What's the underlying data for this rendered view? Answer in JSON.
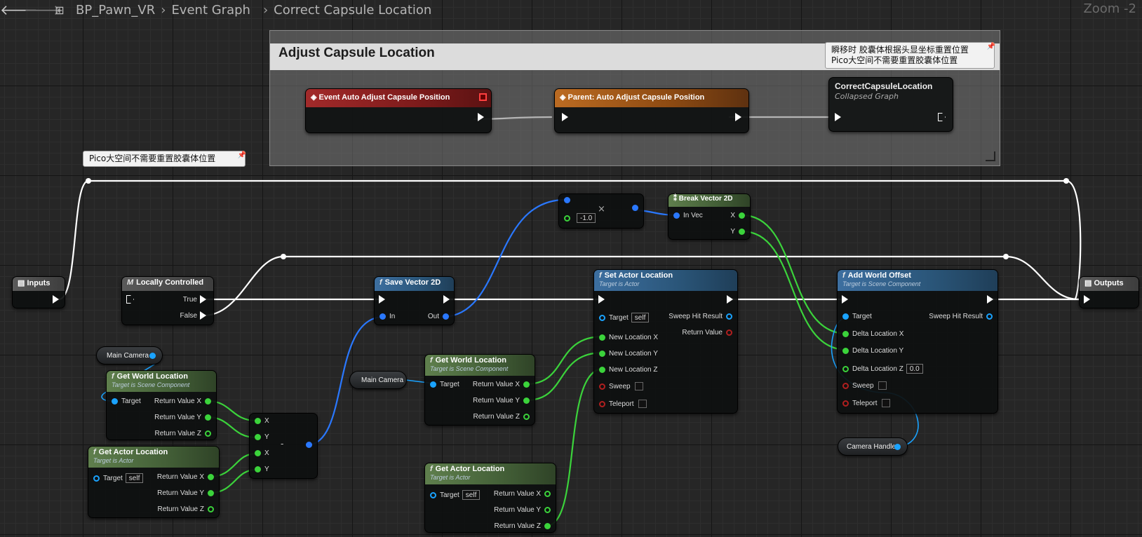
{
  "toolbar": {
    "breadcrumb": [
      "BP_Pawn_VR",
      "Event Graph",
      "Correct Capsule Location"
    ],
    "zoom": "Zoom -2",
    "back_icon": "back-arrow-icon",
    "forward_icon": "forward-arrow-icon",
    "graph_icon": "blueprint-graph-icon"
  },
  "comment_box": {
    "title": "Adjust Capsule Location"
  },
  "bubbles": {
    "correct_capsule": [
      "瞬移时 胶囊体根据头显坐标重置位置",
      "Pico大空间不需要重置胶囊体位置"
    ],
    "reroute": "Pico大空间不需要重置胶囊体位置"
  },
  "nodes": {
    "event_adjust": {
      "title": "Event Auto Adjust Capsule Position"
    },
    "parent_adjust": {
      "title": "Parent: Auto Adjust Capsule Position"
    },
    "collapsed": {
      "title": "CorrectCapsuleLocation",
      "subtitle": "Collapsed Graph"
    },
    "inputs": {
      "title": "Inputs"
    },
    "outputs": {
      "title": "Outputs"
    },
    "locally_controlled": {
      "title": "Locally Controlled",
      "true": "True",
      "false": "False"
    },
    "save_vector": {
      "title": "Save Vector 2D",
      "in": "In",
      "out": "Out"
    },
    "multiply": {
      "value": "-1.0"
    },
    "break_vector": {
      "title": "Break Vector 2D",
      "in": "In Vec",
      "x": "X",
      "y": "Y"
    },
    "set_actor_location": {
      "title": "Set Actor Location",
      "subtitle": "Target is Actor",
      "target": "Target",
      "self": "self",
      "x": "New Location X",
      "y": "New Location Y",
      "z": "New Location Z",
      "sweep": "Sweep",
      "teleport": "Teleport",
      "sweep_hit": "Sweep Hit Result",
      "ret": "Return Value"
    },
    "add_world_offset": {
      "title": "Add World Offset",
      "subtitle": "Target is Scene Component",
      "target": "Target",
      "dx": "Delta Location X",
      "dy": "Delta Location Y",
      "dz": "Delta Location Z",
      "dz_val": "0.0",
      "sweep": "Sweep",
      "teleport": "Teleport",
      "sweep_hit": "Sweep Hit Result"
    },
    "gwl_left": {
      "title": "Get World Location",
      "subtitle": "Target is Scene Component",
      "target": "Target",
      "rx": "Return Value X",
      "ry": "Return Value Y",
      "rz": "Return Value Z"
    },
    "gal_left": {
      "title": "Get Actor Location",
      "subtitle": "Target is Actor",
      "target": "Target",
      "self": "self",
      "rx": "Return Value X",
      "ry": "Return Value Y",
      "rz": "Return Value Z"
    },
    "subtract": {
      "x1": "X",
      "y1": "Y",
      "x2": "X",
      "y2": "Y",
      "op": "-"
    },
    "gwl_mid": {
      "title": "Get World Location",
      "subtitle": "Target is Scene Component",
      "target": "Target",
      "rx": "Return Value X",
      "ry": "Return Value Y",
      "rz": "Return Value Z"
    },
    "gal_mid": {
      "title": "Get Actor Location",
      "subtitle": "Target is Actor",
      "target": "Target",
      "self": "self",
      "rx": "Return Value X",
      "ry": "Return Value Y",
      "rz": "Return Value Z"
    }
  },
  "variables": {
    "main_camera_1": "Main Camera",
    "main_camera_2": "Main Camera",
    "camera_handle": "Camera Handle"
  },
  "colors": {
    "exec": "#ffffff",
    "float": "#3bd33b",
    "vector2d": "#2a78ff",
    "object": "#1aa3ff",
    "struct": "#1aa3ff",
    "bool": "#b01f1f"
  }
}
